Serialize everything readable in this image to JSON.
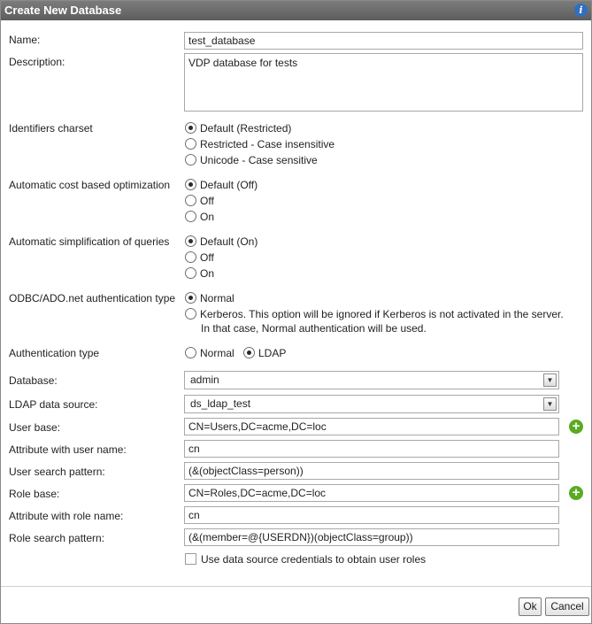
{
  "dialog": {
    "title": "Create New Database"
  },
  "fields": {
    "name_label": "Name:",
    "name_value": "test_database",
    "description_label": "Description:",
    "description_value": "VDP database for tests",
    "charset_label": "Identifiers charset",
    "charset_options": [
      "Default (Restricted)",
      "Restricted - Case insensitive",
      "Unicode - Case sensitive"
    ],
    "cbo_label": "Automatic cost based optimization",
    "cbo_options": [
      "Default (Off)",
      "Off",
      "On"
    ],
    "simplification_label": "Automatic simplification of queries",
    "simplification_options": [
      "Default (On)",
      "Off",
      "On"
    ],
    "odbc_label": "ODBC/ADO.net authentication type",
    "odbc_options": [
      "Normal",
      "Kerberos. This option will be ignored if Kerberos is not activated in the server.",
      "In that case, Normal authentication will be used."
    ],
    "auth_label": "Authentication type",
    "auth_options": [
      "Normal",
      "LDAP"
    ],
    "database_label": "Database:",
    "database_value": "admin",
    "ldap_source_label": "LDAP data source:",
    "ldap_source_value": "ds_ldap_test",
    "user_base_label": "User base:",
    "user_base_value": "CN=Users,DC=acme,DC=loc",
    "user_attr_label": "Attribute with user name:",
    "user_attr_value": "cn",
    "user_search_label": "User search pattern:",
    "user_search_value": "(&(objectClass=person))",
    "role_base_label": "Role base:",
    "role_base_value": "CN=Roles,DC=acme,DC=loc",
    "role_attr_label": "Attribute with role name:",
    "role_attr_value": "cn",
    "role_search_label": "Role search pattern:",
    "role_search_value": "(&(member=@{USERDN})(objectClass=group))",
    "credentials_checkbox_label": "Use data source credentials to obtain user roles"
  },
  "selected": {
    "charset": "Default (Restricted)",
    "cbo": "Default (Off)",
    "simplification": "Default (On)",
    "odbc": "Normal",
    "auth": "LDAP",
    "use_credentials": false
  },
  "buttons": {
    "ok": "Ok",
    "cancel": "Cancel"
  },
  "icons": {
    "info": "info-icon",
    "add": "add-icon",
    "dropdown": "chevron-down-icon"
  },
  "colors": {
    "titlebar": "#6b6b6b",
    "add_icon": "#5aaa22",
    "info_icon": "#2f6fbf"
  }
}
